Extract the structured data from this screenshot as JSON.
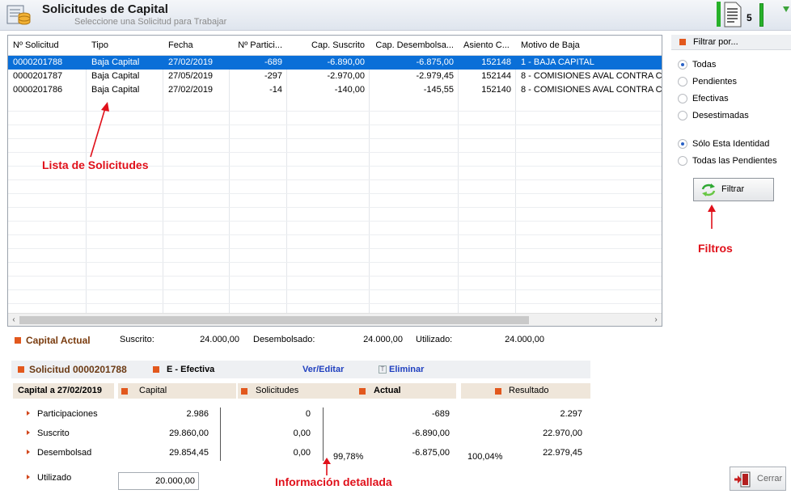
{
  "header": {
    "title": "Solicitudes de Capital",
    "subtitle": "Seleccione una Solicitud para Trabajar",
    "count": "5"
  },
  "grid": {
    "columns": [
      "Nº Solicitud",
      "Tipo",
      "Fecha",
      "Nº Partici...",
      "Cap. Suscrito",
      "Cap. Desembolsa...",
      "Asiento C...",
      "Motivo de Baja"
    ],
    "rows": [
      {
        "id": "0000201788",
        "tipo": "Baja Capital",
        "fecha": "27/02/2019",
        "particip": "-689",
        "suscrito": "-6.890,00",
        "desemb": "-6.875,00",
        "asiento": "152148",
        "motivo": "1 - BAJA CAPITAL"
      },
      {
        "id": "0000201787",
        "tipo": "Baja Capital",
        "fecha": "27/05/2019",
        "particip": "-297",
        "suscrito": "-2.970,00",
        "desemb": "-2.979,45",
        "asiento": "152144",
        "motivo": "8 - COMISIONES AVAL CONTRA CA"
      },
      {
        "id": "0000201786",
        "tipo": "Baja Capital",
        "fecha": "27/02/2019",
        "particip": "-14",
        "suscrito": "-140,00",
        "desemb": "-145,55",
        "asiento": "152140",
        "motivo": "8 - COMISIONES AVAL CONTRA CA"
      }
    ],
    "selected_row": 0
  },
  "filters": {
    "title": "Filtrar por...",
    "status_options": [
      "Todas",
      "Pendientes",
      "Efectivas",
      "Desestimadas"
    ],
    "status_selected": "Todas",
    "scope_options": [
      "Sólo Esta Identidad",
      "Todas las Pendientes"
    ],
    "scope_selected": "Sólo Esta Identidad",
    "button_label": "Filtrar"
  },
  "annotations": {
    "list": "Lista de Solicitudes",
    "filters": "Filtros",
    "detail": "Información detallada"
  },
  "capital_actual": {
    "title": "Capital Actual",
    "suscrito_label": "Suscrito:",
    "suscrito": "24.000,00",
    "desembolsado_label": "Desembolsado:",
    "desembolsado": "24.000,00",
    "utilizado_label": "Utilizado:",
    "utilizado": "24.000,00"
  },
  "solicitud": {
    "title": "Solicitud 0000201788",
    "estado": "E - Efectiva",
    "edit_link": "Ver/Editar",
    "delete_link": "Eliminar"
  },
  "detail": {
    "date_header": "Capital a 27/02/2019",
    "col_capital": "Capital",
    "col_solicitudes": "Solicitudes",
    "col_actual": "Actual",
    "col_resultado": "Resultado",
    "rows": [
      {
        "label": "Participaciones",
        "capital": "2.986",
        "solicitudes": "0",
        "actual": "-689",
        "resultado": "2.297"
      },
      {
        "label": "Suscrito",
        "capital": "29.860,00",
        "solicitudes": "0,00",
        "actual": "-6.890,00",
        "resultado": "22.970,00"
      },
      {
        "label": "Desembolsad",
        "capital": "29.854,45",
        "solicitudes": "0,00",
        "actual": "-6.875,00",
        "resultado": "22.979,45"
      }
    ],
    "pct_actual": "99,78%",
    "pct_resultado": "100,04%",
    "utilizado_label": "Utilizado",
    "utilizado_value": "20.000,00"
  },
  "footer": {
    "close_label": "Cerrar"
  },
  "colors": {
    "selection": "#0a6fd8",
    "accent_orange": "#e2581d",
    "annotation_red": "#e0101a",
    "indicator_green": "#27b12a"
  }
}
